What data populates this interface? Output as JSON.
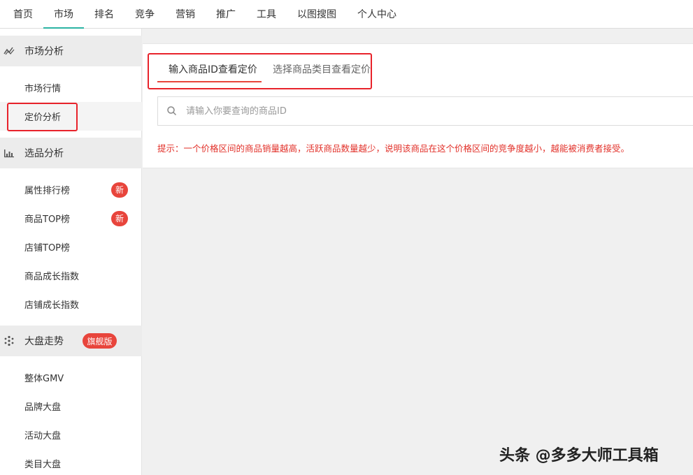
{
  "topnav": {
    "items": [
      {
        "label": "首页"
      },
      {
        "label": "市场",
        "active": true
      },
      {
        "label": "排名"
      },
      {
        "label": "竞争"
      },
      {
        "label": "营销"
      },
      {
        "label": "推广"
      },
      {
        "label": "工具"
      },
      {
        "label": "以图搜图"
      },
      {
        "label": "个人中心"
      }
    ]
  },
  "sidebar": {
    "market": {
      "title": "市场分析",
      "icon": "trend-line-icon",
      "items": [
        {
          "label": "市场行情"
        },
        {
          "label": "定价分析",
          "selected": true
        }
      ]
    },
    "product": {
      "title": "选品分析",
      "icon": "bar-chart-icon",
      "items": [
        {
          "label": "属性排行榜",
          "badge": "新"
        },
        {
          "label": "商品TOP榜",
          "badge": "新"
        },
        {
          "label": "店铺TOP榜"
        },
        {
          "label": "商品成长指数"
        },
        {
          "label": "店铺成长指数"
        }
      ]
    },
    "overview": {
      "title": "大盘走势",
      "icon": "sparkle-icon",
      "badge": "旗舰版",
      "items": [
        {
          "label": "整体GMV"
        },
        {
          "label": "品牌大盘"
        },
        {
          "label": "活动大盘"
        },
        {
          "label": "类目大盘"
        }
      ]
    }
  },
  "main": {
    "tabs": [
      {
        "label": "输入商品ID查看定价",
        "active": true
      },
      {
        "label": "选择商品类目查看定价"
      }
    ],
    "search": {
      "placeholder": "请输入你要查询的商品ID",
      "value": ""
    },
    "hint": "提示：一个价格区间的商品销量越高，活跃商品数量越少，说明该商品在这个价格区间的竞争度越小，越能被消费者接受。"
  },
  "watermark": "头条 @多多大师工具箱",
  "colors": {
    "accent": "#2bb3a3",
    "badge": "#e8453c",
    "hint": "#e2312a",
    "highlight_box": "#e8232b"
  }
}
